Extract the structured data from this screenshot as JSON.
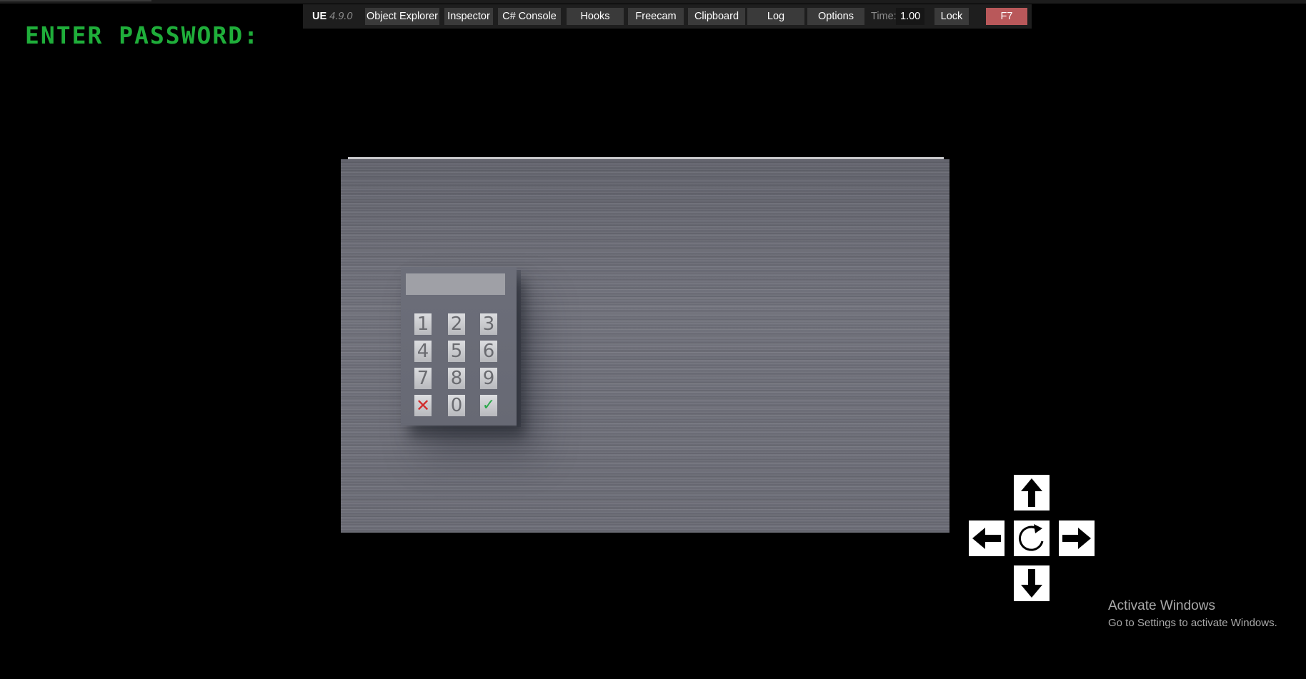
{
  "prompt": {
    "text": "ENTER PASSWORD:",
    "color": "#1fae3a"
  },
  "toolbar": {
    "brand": "UE",
    "version": "4.9.0",
    "buttons": {
      "object_explorer": "Object Explorer",
      "inspector": "Inspector",
      "console": "C# Console",
      "hooks": "Hooks",
      "freecam": "Freecam",
      "clipboard": "Clipboard",
      "log": "Log",
      "options": "Options",
      "lock": "Lock",
      "toggle": "F7"
    },
    "time_label": "Time:",
    "time_value": "1.00"
  },
  "keypad": {
    "keys": {
      "k1": "1",
      "k2": "2",
      "k3": "3",
      "k4": "4",
      "k5": "5",
      "k6": "6",
      "k7": "7",
      "k8": "8",
      "k9": "9",
      "cancel": "✕",
      "k0": "0",
      "ok": "✓"
    }
  },
  "controls": {
    "up": "arrow-up-icon",
    "left": "arrow-left-icon",
    "rotate": "rotate-icon",
    "right": "arrow-right-icon",
    "down": "arrow-down-icon"
  },
  "watermark": {
    "title": "Activate Windows",
    "subtitle": "Go to Settings to activate Windows."
  }
}
